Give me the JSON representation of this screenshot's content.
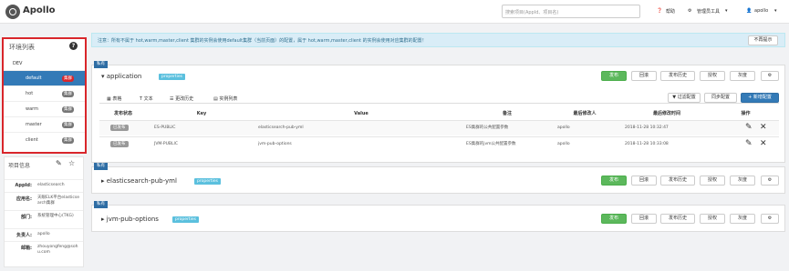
{
  "header": {
    "logo_text": "Apollo",
    "search_placeholder": "搜索项目(AppId、项目名)",
    "help": "帮助",
    "admin_tools": "管理员工具",
    "user": "apollo"
  },
  "env_list": {
    "title": "环境列表",
    "help_icon": "?",
    "env": "DEV",
    "clusters": [
      {
        "name": "default",
        "badge": "集群",
        "active": true
      },
      {
        "name": "hot",
        "badge": "集群",
        "active": false
      },
      {
        "name": "warm",
        "badge": "集群",
        "active": false
      },
      {
        "name": "master",
        "badge": "集群",
        "active": false
      },
      {
        "name": "client",
        "badge": "集群",
        "active": false
      }
    ]
  },
  "project_info": {
    "title": "项目信息",
    "rows": [
      {
        "key": "AppId:",
        "value": "elasticsearch"
      },
      {
        "key": "应用名:",
        "value": "天眼ELK平台elasticsearch集群"
      },
      {
        "key": "部门:",
        "value": "系统管理中心(TKG)"
      },
      {
        "key": "负责人:",
        "value": "apollo"
      },
      {
        "key": "邮箱:",
        "value": "zhouyongfeng@sohu.com"
      }
    ]
  },
  "notice": {
    "text": "注意：所有不属于 hot,warm,master,client 集群的实例会使用default集群（当前页面）的配置，属于 hot,warm,master,client 的实例会使用对应集群的配置！",
    "button": "不再提示"
  },
  "namespaces": [
    {
      "tag": "私有",
      "name": "application",
      "format": "properties",
      "buttons": {
        "publish": "发布",
        "rollback": "回滚",
        "history": "发布历史",
        "grant": "授权",
        "gray": "灰度",
        "more": "⚙"
      },
      "tabs": [
        "表格",
        "文本",
        "更改历史",
        "实例列表"
      ],
      "filter": "过滤配置",
      "sync": "同步配置",
      "add": "+ 新增配置",
      "columns": [
        "发布状态",
        "Key",
        "Value",
        "备注",
        "最后修改人",
        "最后修改时间",
        "操作"
      ],
      "rows": [
        {
          "status": "已发布",
          "key": "ES-PUBLIC",
          "value": "elasticsearch-pub-yml",
          "comment": "ES集群的公共配置参数",
          "modifier": "apollo",
          "time": "2018-11-28 10:32:47"
        },
        {
          "status": "已发布",
          "key": "JVM-PUBLIC",
          "value": "jvm-pub-options",
          "comment": "ES集群的jvm公共配置参数",
          "modifier": "apollo",
          "time": "2018-11-28 10:33:08"
        }
      ]
    },
    {
      "tag": "私有",
      "name": "elasticsearch-pub-yml",
      "format": "properties",
      "buttons": {
        "publish": "发布",
        "rollback": "回滚",
        "history": "发布历史",
        "grant": "授权",
        "gray": "灰度",
        "more": "⚙"
      }
    },
    {
      "tag": "私有",
      "name": "jvm-pub-options",
      "format": "properties",
      "buttons": {
        "publish": "发布",
        "rollback": "回滚",
        "history": "发布历史",
        "grant": "授权",
        "gray": "灰度",
        "more": "⚙"
      }
    }
  ]
}
